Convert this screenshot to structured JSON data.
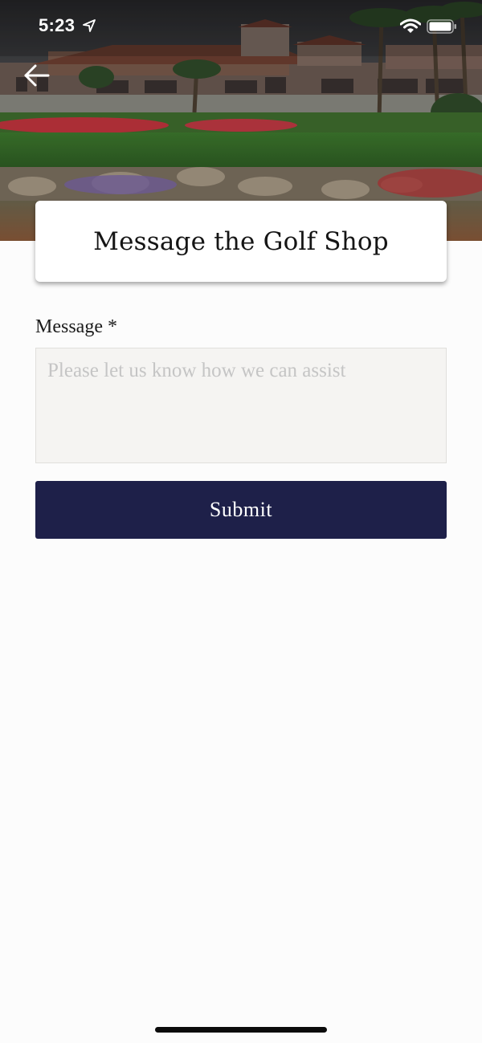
{
  "status_bar": {
    "time": "5:23",
    "location_icon": "location-arrow-icon",
    "wifi_icon": "wifi-icon",
    "battery_icon": "battery-icon"
  },
  "header": {
    "back_icon": "arrow-left-icon",
    "image": "golf-course-clubhouse-photo"
  },
  "page": {
    "title": "Message the Golf Shop"
  },
  "form": {
    "message_label": "Message *",
    "message_placeholder": "Please let us know how we can assist",
    "message_value": "",
    "submit_label": "Submit"
  },
  "colors": {
    "accent": "#1e2049",
    "background": "#fcfcfc",
    "input_background": "#f5f4f2"
  }
}
